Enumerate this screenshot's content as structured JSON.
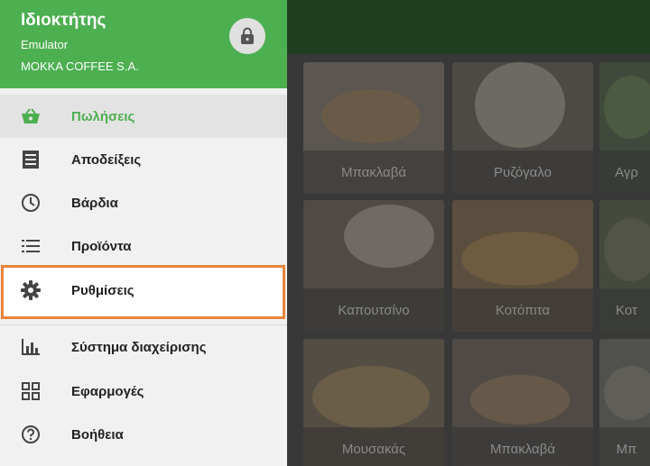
{
  "header": {
    "title": "Ιδιοκτήτης",
    "device": "Emulator",
    "company": "MOKKA COFFEE S.A."
  },
  "menu": {
    "items": [
      {
        "label": "Πωλήσεις",
        "icon": "basket-icon"
      },
      {
        "label": "Αποδείξεις",
        "icon": "receipt-icon"
      },
      {
        "label": "Βάρδια",
        "icon": "clock-icon"
      },
      {
        "label": "Προϊόντα",
        "icon": "list-icon"
      },
      {
        "label": "Ρυθμίσεις",
        "icon": "gear-icon"
      },
      {
        "label": "Σύστημα διαχείρισης",
        "icon": "bar-chart-icon"
      },
      {
        "label": "Εφαρμογές",
        "icon": "apps-icon"
      },
      {
        "label": "Βοήθεια",
        "icon": "help-icon"
      }
    ]
  },
  "products": [
    {
      "name": "Μπακλαβά"
    },
    {
      "name": "Ρυζόγαλο"
    },
    {
      "name": "Αγρ"
    },
    {
      "name": "Καπουτσίνο"
    },
    {
      "name": "Κοτόπιτα"
    },
    {
      "name": "Κοτ"
    },
    {
      "name": "Μουσακάς"
    },
    {
      "name": "Μπακλαβά"
    },
    {
      "name": "Μπ"
    }
  ],
  "colors": {
    "accent": "#4caf50",
    "highlight": "#e8843b"
  }
}
